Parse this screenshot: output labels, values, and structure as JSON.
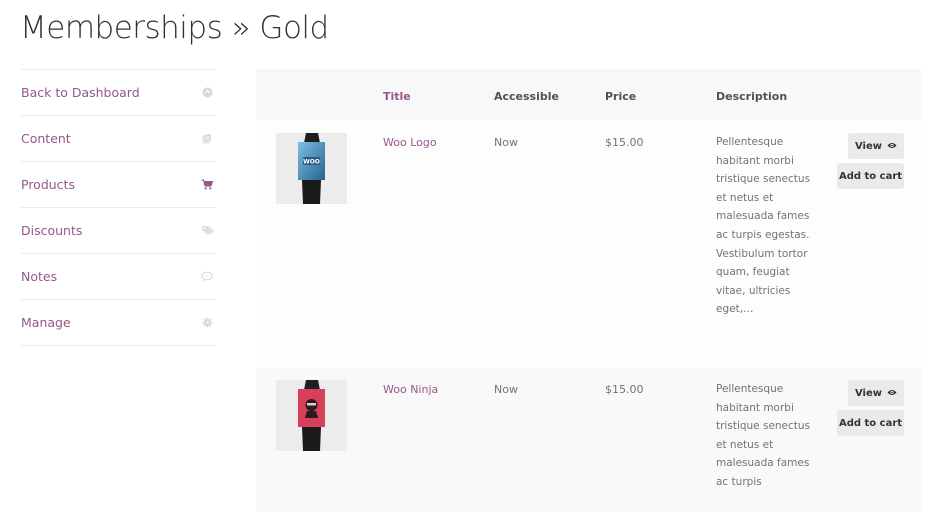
{
  "page": {
    "title": "Memberships » Gold"
  },
  "sidebar": {
    "items": [
      {
        "label": "Back to Dashboard",
        "icon": "dashboard-icon",
        "active": false
      },
      {
        "label": "Content",
        "icon": "content-icon",
        "active": false
      },
      {
        "label": "Products",
        "icon": "cart-icon",
        "active": true
      },
      {
        "label": "Discounts",
        "icon": "tag-icon",
        "active": false
      },
      {
        "label": "Notes",
        "icon": "speech-bubble-icon",
        "active": false
      },
      {
        "label": "Manage",
        "icon": "gear-icon",
        "active": false
      }
    ]
  },
  "table": {
    "headers": {
      "title": "Title",
      "accessible": "Accessible",
      "price": "Price",
      "description": "Description"
    },
    "rows": [
      {
        "title": "Woo Logo",
        "accessible": "Now",
        "price": "$15.00",
        "description": "Pellentesque habitant morbi tristique senectus et netus et malesuada fames ac turpis egestas. Vestibulum tortor quam, feugiat vitae, ultricies eget,…",
        "thumbnail": "woo-logo-poster",
        "view_label": "View",
        "cart_label": "Add to cart"
      },
      {
        "title": "Woo Ninja",
        "accessible": "Now",
        "price": "$15.00",
        "description": "Pellentesque habitant morbi tristique senectus et netus et malesuada fames ac turpis",
        "thumbnail": "woo-ninja-poster",
        "view_label": "View",
        "cart_label": "Add to cart"
      }
    ]
  },
  "colors": {
    "accent": "#96588a",
    "icon_muted": "#d6d6d6",
    "icon_active": "#96588a",
    "header_bg": "#f8f8f8",
    "button_bg": "#ebe9eb"
  }
}
